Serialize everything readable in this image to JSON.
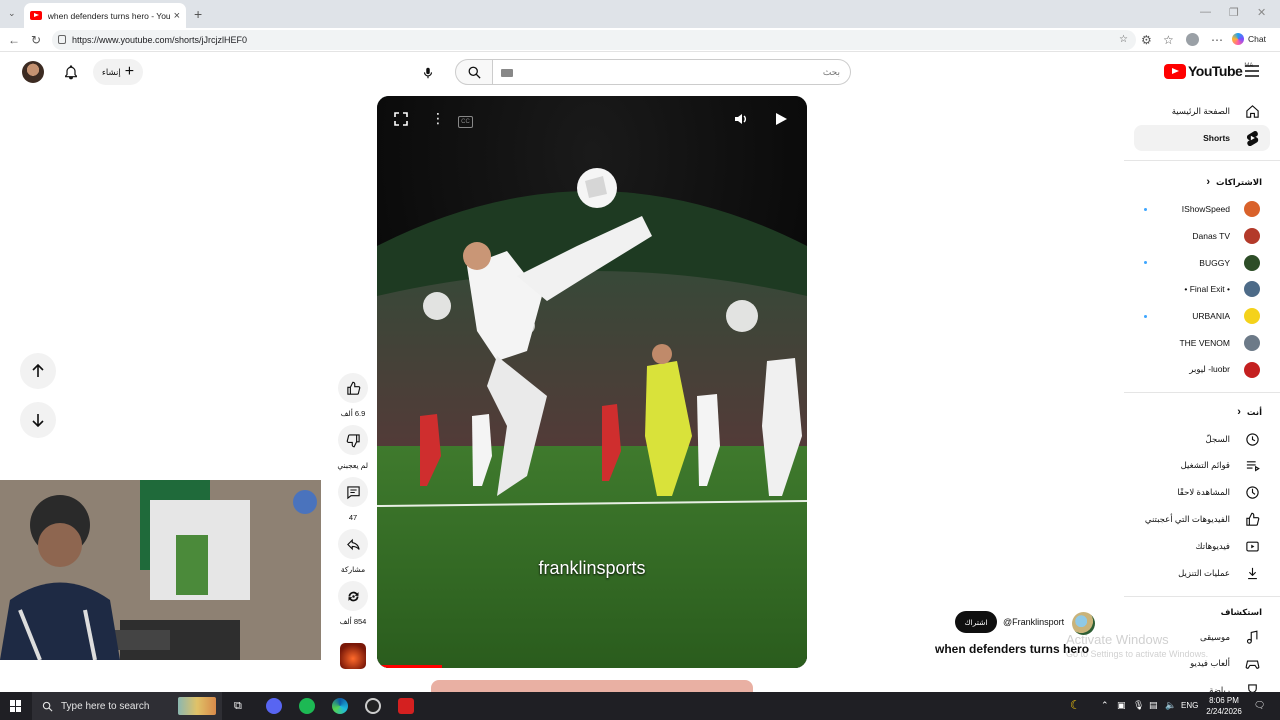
{
  "browser": {
    "tab_title": "when defenders turns hero - YouTube",
    "tab_close": "×",
    "new_tab": "+",
    "url": "https://www.youtube.com/shorts/jJrcjzlHEF0",
    "chat_label": "Chat",
    "window_controls": [
      "—",
      "❐",
      "✕"
    ]
  },
  "header": {
    "search_placeholder": "بحث",
    "create_label": "إنشاء",
    "logo_text": "YouTube",
    "country_code": "MA"
  },
  "sidebar": {
    "main": [
      {
        "label": "الصفحة الرئيسية",
        "icon": "home-icon"
      },
      {
        "label": "Shorts",
        "icon": "shorts-icon",
        "active": true
      }
    ],
    "subscriptions_heading": "الاشتراكات",
    "subscriptions": [
      {
        "label": "IShowSpeed",
        "color": "#d9622b",
        "new": true
      },
      {
        "label": "Danas TV",
        "color": "#b33a2a",
        "new": false
      },
      {
        "label": "BUGGY",
        "color": "#2d4d27",
        "new": true
      },
      {
        "label": "• Final Exit •",
        "color": "#4d6b88",
        "new": false
      },
      {
        "label": "URBANIA",
        "color": "#f4d21b",
        "new": true
      },
      {
        "label": "THE VENOM",
        "color": "#6c7a88",
        "new": false
      },
      {
        "label": "luobr- ليوبر",
        "color": "#c42020",
        "new": false
      }
    ],
    "you_heading": "أنت",
    "you": [
      {
        "label": "السجلّ",
        "icon": "history-icon"
      },
      {
        "label": "قوائم التشغيل",
        "icon": "playlists-icon"
      },
      {
        "label": "المشاهدة لاحقًا",
        "icon": "watch-later-icon"
      },
      {
        "label": "الفيديوهات التي أعجبتني",
        "icon": "liked-icon"
      },
      {
        "label": "فيديوهاتك",
        "icon": "your-videos-icon"
      },
      {
        "label": "عمليات التنزيل",
        "icon": "downloads-icon"
      }
    ],
    "explore_heading": "استكشاف",
    "explore": [
      {
        "label": "موسيقى",
        "icon": "music-icon"
      },
      {
        "label": "ألعاب فيديو",
        "icon": "gaming-icon"
      },
      {
        "label": "رياضة",
        "icon": "sports-icon"
      }
    ]
  },
  "short": {
    "watermark": "franklinsports",
    "progress": 0.15,
    "title": "when defenders turns hero",
    "channel_handle": "@Franklinsport",
    "subscribe_label": "اشتراك",
    "likes": "6.9 ألف",
    "dislike_label": "لم يعجبني",
    "comments": "47",
    "share_label": "مشاركة",
    "remix_count": "854 ألف"
  },
  "os": {
    "taskbar_search": "Type here to search",
    "language": "ENG",
    "time": "8:06 PM",
    "date": "2/24/2026",
    "watermark_line1": "Activate Windows",
    "watermark_line2": "Go to Settings to activate Windows."
  }
}
